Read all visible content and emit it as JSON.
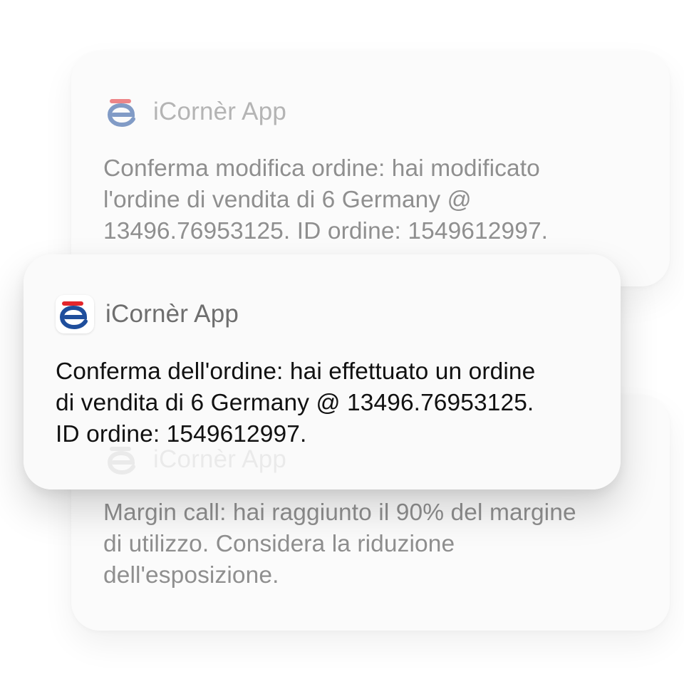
{
  "notifications": [
    {
      "app_name": "iCornèr App",
      "message": "Conferma modifica ordine: hai modificato\nl'ordine di vendita di 6 Germany @\n13496.76953125. ID ordine: 1549612997."
    },
    {
      "app_name": "iCornèr App",
      "message": "Conferma dell'ordine: hai effettuato un ordine\ndi vendita di 6 Germany @ 13496.76953125.\nID ordine: 1549612997."
    },
    {
      "app_name": "iCornèr App",
      "message": "Margin call: hai raggiunto il 90% del margine\ndi utilizzo. Considera la riduzione\ndell'esposizione."
    }
  ],
  "icons": {
    "app_icon": "icorner-logo-icon"
  },
  "colors": {
    "logo_red": "#e3262c",
    "logo_blue": "#1f4e9c",
    "card_background": "#fafafa",
    "faded_text": "#8f8f8f",
    "primary_text": "#111111"
  }
}
